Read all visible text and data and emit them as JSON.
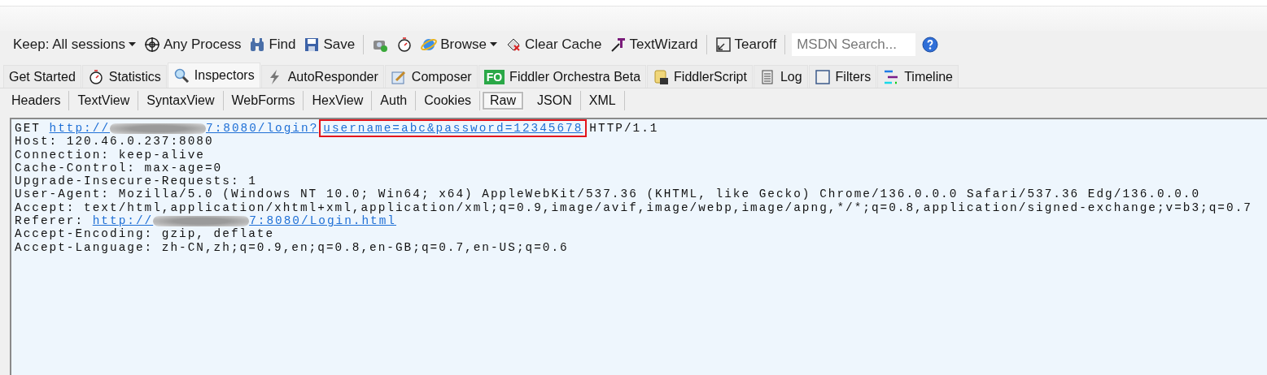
{
  "toolbar": [
    {
      "kind": "dropdown",
      "label": "Keep: All sessions"
    },
    {
      "kind": "button",
      "label": "Any Process"
    },
    {
      "kind": "button",
      "label": "Find"
    },
    {
      "kind": "button",
      "label": "Save"
    },
    {
      "kind": "separator"
    },
    {
      "kind": "icon_button"
    },
    {
      "kind": "icon_button"
    },
    {
      "kind": "split_button",
      "label": "Browse"
    },
    {
      "kind": "button",
      "label": "Clear Cache"
    },
    {
      "kind": "button",
      "label": "TextWizard"
    },
    {
      "kind": "separator"
    },
    {
      "kind": "button",
      "label": "Tearoff"
    },
    {
      "kind": "separator"
    },
    {
      "kind": "search",
      "placeholder": "MSDN Search..."
    },
    {
      "kind": "help"
    }
  ],
  "tabs": [
    {
      "label": "Get Started",
      "selected": false
    },
    {
      "label": "Statistics",
      "selected": false
    },
    {
      "label": "Inspectors",
      "selected": true
    },
    {
      "label": "AutoResponder",
      "selected": false
    },
    {
      "label": "Composer",
      "selected": false
    },
    {
      "label": "Fiddler Orchestra Beta",
      "badge": "FO",
      "selected": false
    },
    {
      "label": "FiddlerScript",
      "selected": false
    },
    {
      "label": "Log",
      "selected": false
    },
    {
      "label": "Filters",
      "selected": false
    },
    {
      "label": "Timeline",
      "selected": false
    }
  ],
  "inspector_tabs": [
    {
      "label": "Headers",
      "selected": false
    },
    {
      "label": "TextView",
      "selected": false
    },
    {
      "label": "SyntaxView",
      "selected": false
    },
    {
      "label": "WebForms",
      "selected": false
    },
    {
      "label": "HexView",
      "selected": false
    },
    {
      "label": "Auth",
      "selected": false
    },
    {
      "label": "Cookies",
      "selected": false
    },
    {
      "label": "Raw",
      "selected": true
    },
    {
      "label": "JSON",
      "selected": false
    },
    {
      "label": "XML",
      "selected": false
    }
  ],
  "raw_lines": [
    {
      "segments": [
        {
          "kind": "text",
          "text": "GET"
        },
        {
          "kind": "link",
          "text": "http://"
        },
        {
          "kind": "redacted"
        },
        {
          "kind": "link",
          "text": "7:8080/login?"
        },
        {
          "kind": "highlight",
          "text": "username=abc&password=12345678"
        },
        {
          "kind": "text",
          "text": "HTTP/1.1"
        }
      ]
    },
    {
      "segments": [
        {
          "kind": "text",
          "text": "Host: 120.46.0.237:8080"
        }
      ]
    },
    {
      "segments": [
        {
          "kind": "text",
          "text": "Connection: keep-alive"
        }
      ]
    },
    {
      "segments": [
        {
          "kind": "text",
          "text": "Cache-Control: max-age=0"
        }
      ]
    },
    {
      "segments": [
        {
          "kind": "text",
          "text": "Upgrade-Insecure-Requests: 1"
        }
      ]
    },
    {
      "segments": [
        {
          "kind": "text",
          "text": "User-Agent: Mozilla/5.0 (Windows NT 10.0; Win64; x64) AppleWebKit/537.36 (KHTML, like Gecko) Chrome/136.0.0.0 Safari/537.36 Edg/136.0.0.0"
        }
      ]
    },
    {
      "segments": [
        {
          "kind": "text",
          "text": "Accept: text/html,application/xhtml+xml,application/xml;q=0.9,image/avif,image/webp,image/apng,*/*;q=0.8,application/signed-exchange;v=b3;q=0.7"
        }
      ]
    },
    {
      "segments": [
        {
          "kind": "text",
          "text": "Referer:"
        },
        {
          "kind": "link",
          "text": "http://"
        },
        {
          "kind": "redacted"
        },
        {
          "kind": "link",
          "text": "7:8080/Login.html"
        }
      ]
    },
    {
      "segments": [
        {
          "kind": "text",
          "text": "Accept-Encoding: gzip, deflate"
        }
      ]
    },
    {
      "segments": [
        {
          "kind": "text",
          "text": "Accept-Language: zh-CN,zh;q=0.9,en;q=0.8,en-GB;q=0.7,en-US;q=0.6"
        }
      ]
    }
  ]
}
